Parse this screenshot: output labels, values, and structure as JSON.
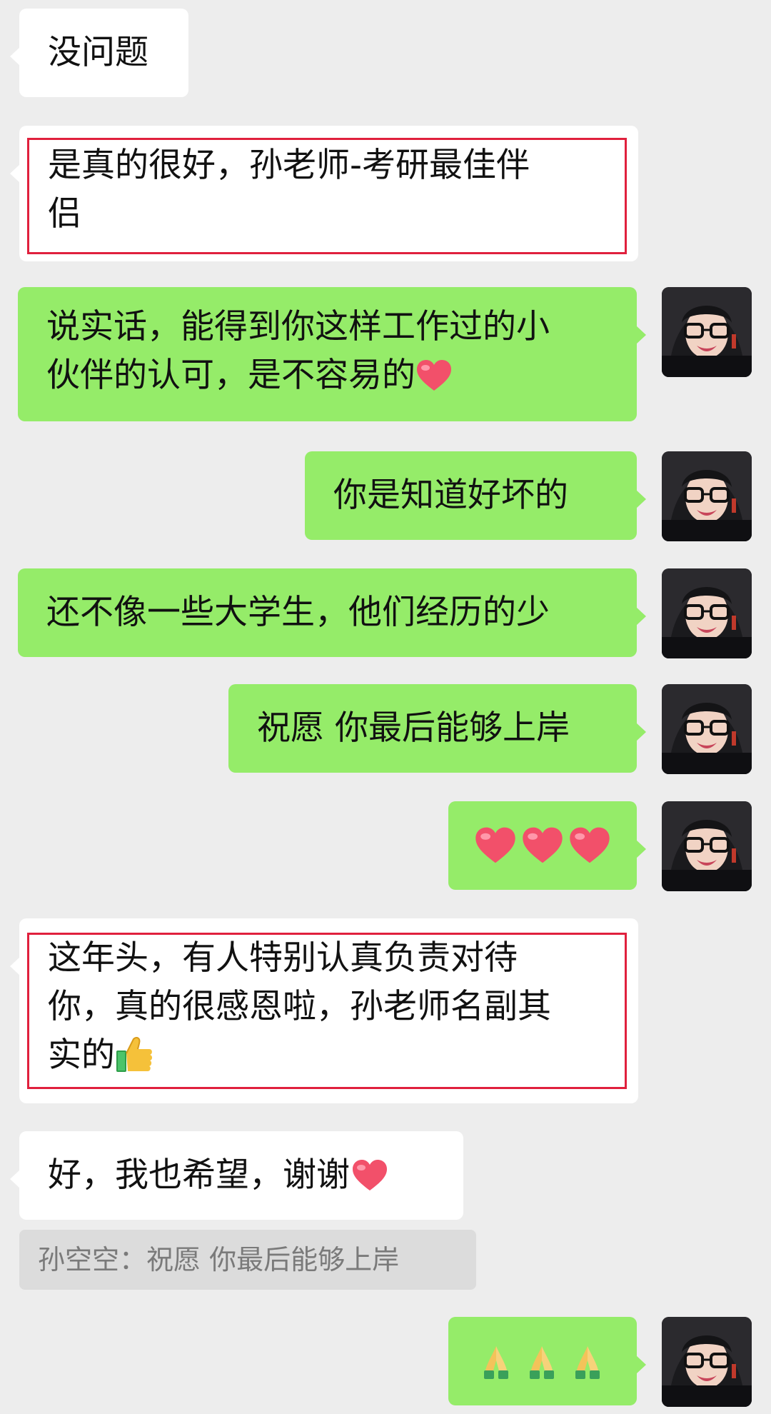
{
  "colors": {
    "background": "#ededed",
    "incoming_bubble": "#ffffff",
    "outgoing_bubble": "#95ec69",
    "highlight_border": "#e0203d",
    "quote_background": "#dcdcdc",
    "quote_text": "#7a7a7a"
  },
  "messages": [
    {
      "direction": "incoming",
      "lines": [
        "没问题"
      ],
      "highlighted": false
    },
    {
      "direction": "incoming",
      "lines": [
        "是真的很好，孙老师-考研最佳伴",
        "侣"
      ],
      "highlighted": true
    },
    {
      "direction": "outgoing",
      "lines": [
        "说实话，能得到你这样工作过的小",
        "伙伴的认可，是不容易的"
      ],
      "trailing_emoji": "red-heart-emoji"
    },
    {
      "direction": "outgoing",
      "lines": [
        "你是知道好坏的"
      ]
    },
    {
      "direction": "outgoing",
      "lines": [
        "还不像一些大学生，他们经历的少"
      ]
    },
    {
      "direction": "outgoing",
      "lines": [
        "祝愿 你最后能够上岸"
      ]
    },
    {
      "direction": "outgoing",
      "lines": [
        ""
      ],
      "emojis": [
        "red-heart-emoji",
        "red-heart-emoji",
        "red-heart-emoji"
      ]
    },
    {
      "direction": "incoming",
      "lines": [
        "这年头，有人特别认真负责对待",
        "你，真的很感恩啦，孙老师名副其",
        "实的"
      ],
      "trailing_emoji": "thumbs-up-emoji",
      "highlighted": true
    },
    {
      "direction": "incoming",
      "lines": [
        "好，我也希望，谢谢"
      ],
      "trailing_emoji": "red-heart-emoji"
    },
    {
      "direction": "outgoing",
      "lines": [
        ""
      ],
      "emojis": [
        "folded-hands-emoji",
        "folded-hands-emoji",
        "folded-hands-emoji"
      ]
    }
  ],
  "quote": {
    "text": "孙空空：祝愿 你最后能够上岸"
  },
  "avatar": {
    "icon": "user-avatar-photo"
  }
}
